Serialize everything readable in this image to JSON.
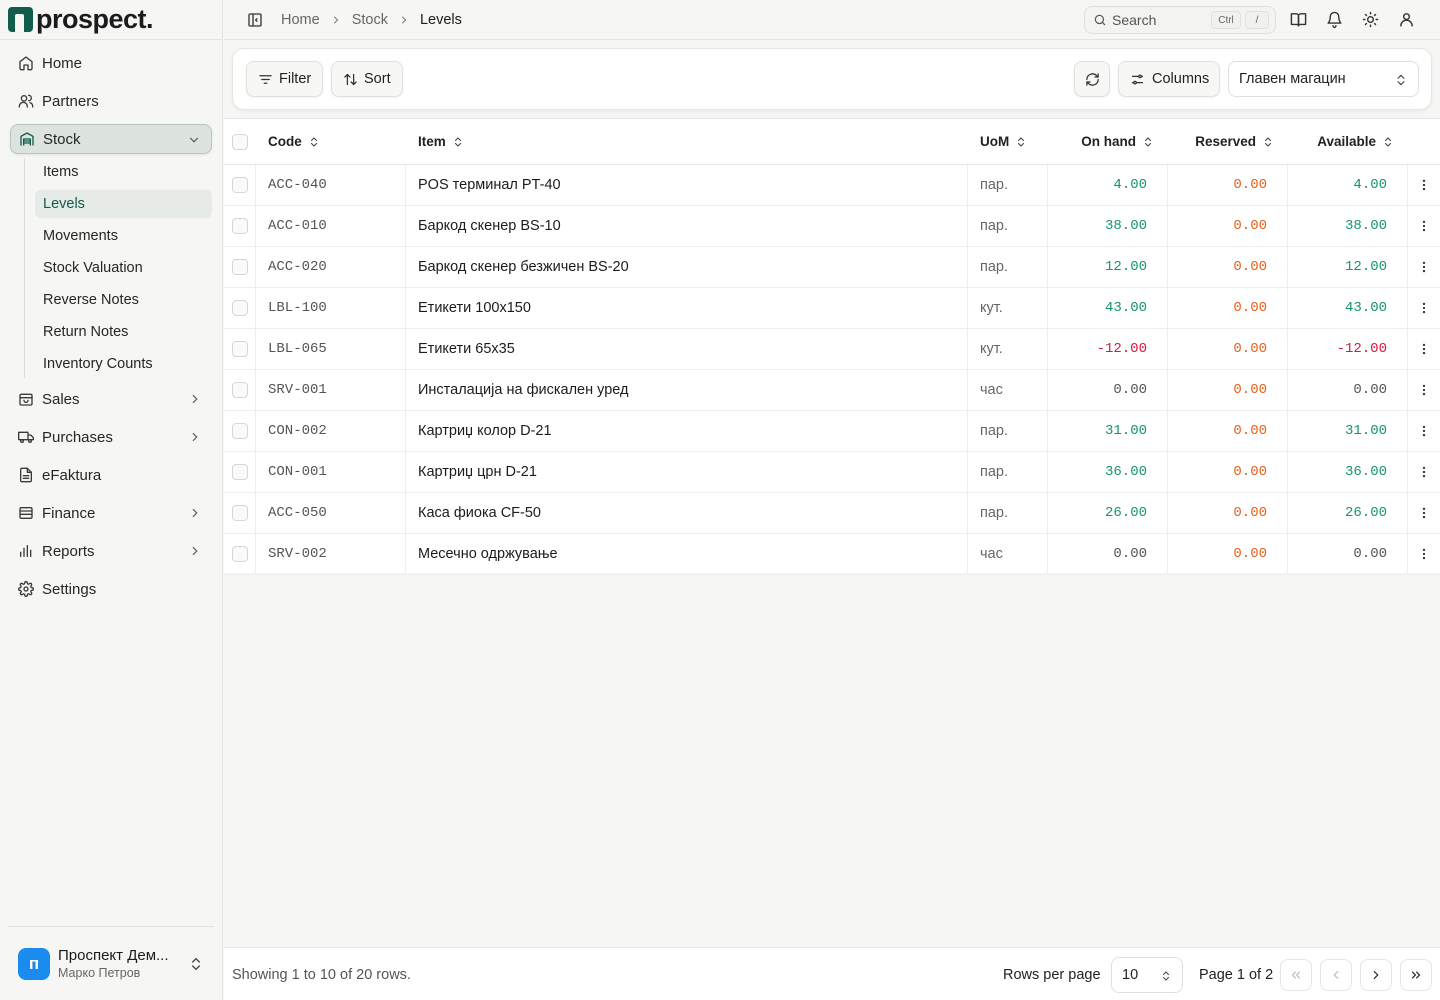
{
  "app": {
    "logo_text": "prospect."
  },
  "sidebar": {
    "items": [
      {
        "label": "Home",
        "icon": "home-icon"
      },
      {
        "label": "Partners",
        "icon": "users-icon"
      },
      {
        "label": "Stock",
        "icon": "warehouse-icon",
        "expanded": true
      },
      {
        "label": "Sales",
        "icon": "shopping-bag-icon"
      },
      {
        "label": "Purchases",
        "icon": "truck-icon"
      },
      {
        "label": "eFaktura",
        "icon": "document-icon"
      },
      {
        "label": "Finance",
        "icon": "wallet-icon"
      },
      {
        "label": "Reports",
        "icon": "bar-chart-icon"
      },
      {
        "label": "Settings",
        "icon": "gear-icon"
      }
    ],
    "stock_sub": [
      "Items",
      "Levels",
      "Movements",
      "Stock Valuation",
      "Reverse Notes",
      "Return Notes",
      "Inventory Counts"
    ],
    "org": {
      "initial": "п",
      "name": "Проспект Дем...",
      "user": "Марко Петров"
    }
  },
  "topbar": {
    "breadcrumbs": [
      "Home",
      "Stock",
      "Levels"
    ],
    "search_placeholder": "Search",
    "kbd_ctrl": "Ctrl",
    "kbd_slash": "/"
  },
  "toolbar": {
    "filter_label": "Filter",
    "sort_label": "Sort",
    "columns_label": "Columns",
    "warehouse": "Главен магацин"
  },
  "table": {
    "columns": [
      "Code",
      "Item",
      "UoM",
      "On hand",
      "Reserved",
      "Available"
    ],
    "rows": [
      {
        "code": "ACC-040",
        "item": "POS терминал PT-40",
        "uom": "пар.",
        "on_hand": "4.00",
        "reserved": "0.00",
        "available": "4.00"
      },
      {
        "code": "ACC-010",
        "item": "Баркод скенер BS-10",
        "uom": "пар.",
        "on_hand": "38.00",
        "reserved": "0.00",
        "available": "38.00"
      },
      {
        "code": "ACC-020",
        "item": "Баркод скенер безжичен BS-20",
        "uom": "пар.",
        "on_hand": "12.00",
        "reserved": "0.00",
        "available": "12.00"
      },
      {
        "code": "LBL-100",
        "item": "Етикети 100x150",
        "uom": "кут.",
        "on_hand": "43.00",
        "reserved": "0.00",
        "available": "43.00"
      },
      {
        "code": "LBL-065",
        "item": "Етикети 65x35",
        "uom": "кут.",
        "on_hand": "-12.00",
        "reserved": "0.00",
        "available": "-12.00"
      },
      {
        "code": "SRV-001",
        "item": "Инсталација на фискален уред",
        "uom": "час",
        "on_hand": "0.00",
        "reserved": "0.00",
        "available": "0.00"
      },
      {
        "code": "CON-002",
        "item": "Картриџ колор D-21",
        "uom": "пар.",
        "on_hand": "31.00",
        "reserved": "0.00",
        "available": "31.00"
      },
      {
        "code": "CON-001",
        "item": "Картриџ црн D-21",
        "uom": "пар.",
        "on_hand": "36.00",
        "reserved": "0.00",
        "available": "36.00"
      },
      {
        "code": "ACC-050",
        "item": "Каса фиока CF-50",
        "uom": "пар.",
        "on_hand": "26.00",
        "reserved": "0.00",
        "available": "26.00"
      },
      {
        "code": "SRV-002",
        "item": "Месечно одржување",
        "uom": "час",
        "on_hand": "0.00",
        "reserved": "0.00",
        "available": "0.00"
      }
    ]
  },
  "footer": {
    "showing": "Showing 1 to 10 of 20 rows.",
    "rows_per_page_label": "Rows per page",
    "rows_per_page": "10",
    "page_info": "Page 1 of 2"
  },
  "colors": {
    "brand": "#0f5d4a",
    "positive": "#17946f",
    "negative": "#e0143c",
    "reserved": "#e8601c"
  }
}
